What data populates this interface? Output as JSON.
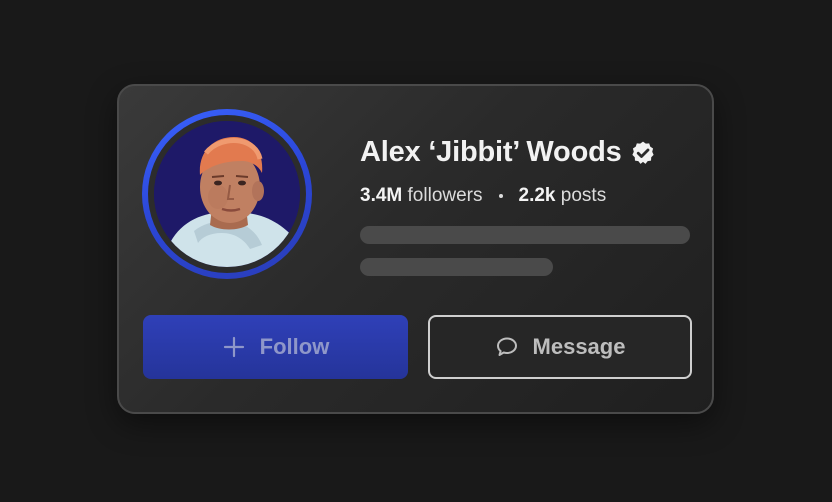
{
  "profile": {
    "name": "Alex ‘Jibbit’ Woods",
    "verified": true,
    "followers_count": "3.4M",
    "followers_label": "followers",
    "posts_count": "2.2k",
    "posts_label": "posts"
  },
  "actions": {
    "follow_label": "Follow",
    "message_label": "Message"
  },
  "icons": {
    "verified": "verified-badge-icon",
    "follow": "plus-icon",
    "message": "chat-bubble-icon"
  },
  "colors": {
    "background": "#191919",
    "card": "#2a2a2a",
    "accent": "#2b46d6",
    "follow_button": "#2a3aa8",
    "skeleton": "#4a4a4a"
  }
}
